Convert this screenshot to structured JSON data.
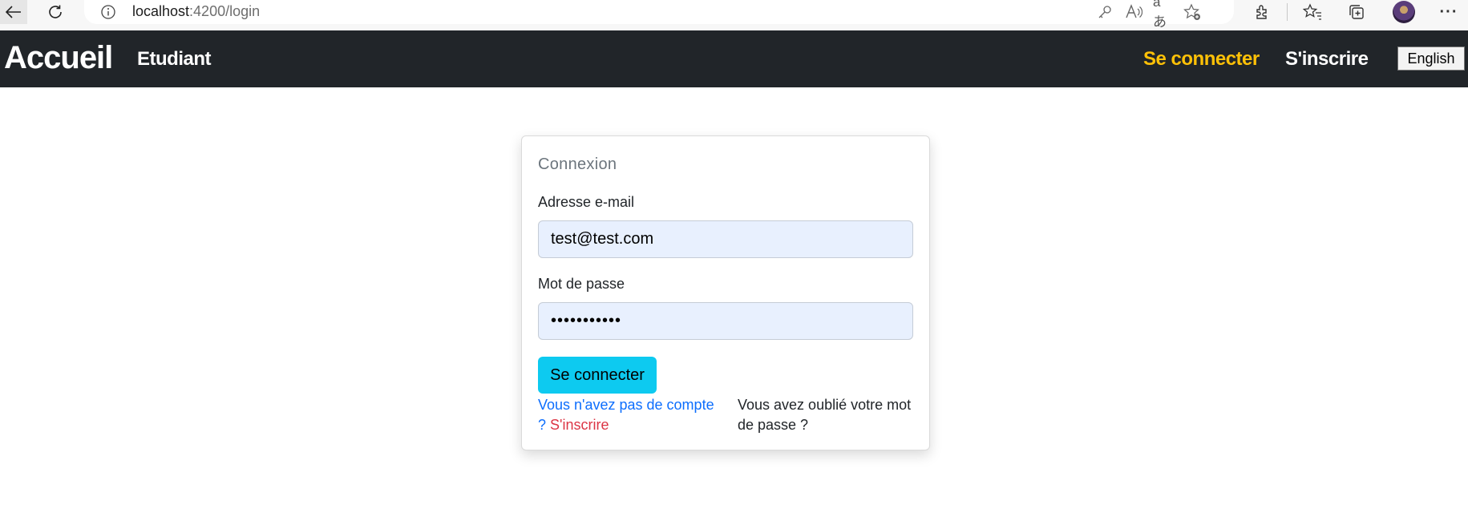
{
  "browser": {
    "url_host": "localhost",
    "url_path": ":4200/login"
  },
  "navbar": {
    "brand": "Accueil",
    "student_link": "Etudiant",
    "login_link": "Se connecter",
    "signup_link": "S'inscrire",
    "language_button": "English",
    "colors": {
      "background": "#212529",
      "active": "#ffc107"
    }
  },
  "login_card": {
    "title": "Connexion",
    "email_label": "Adresse e-mail",
    "email_value": "test@test.com",
    "password_label": "Mot de passe",
    "password_value": "•••••••••••",
    "submit_label": "Se connecter",
    "no_account_text": "Vous n'avez pas de compte ?",
    "signup_link": "S'inscrire",
    "forgot_password": "Vous avez oublié votre mot de passe ?",
    "colors": {
      "submit": "#0dcaf0",
      "link": "#0d6efd",
      "signup": "#dc3545"
    }
  }
}
